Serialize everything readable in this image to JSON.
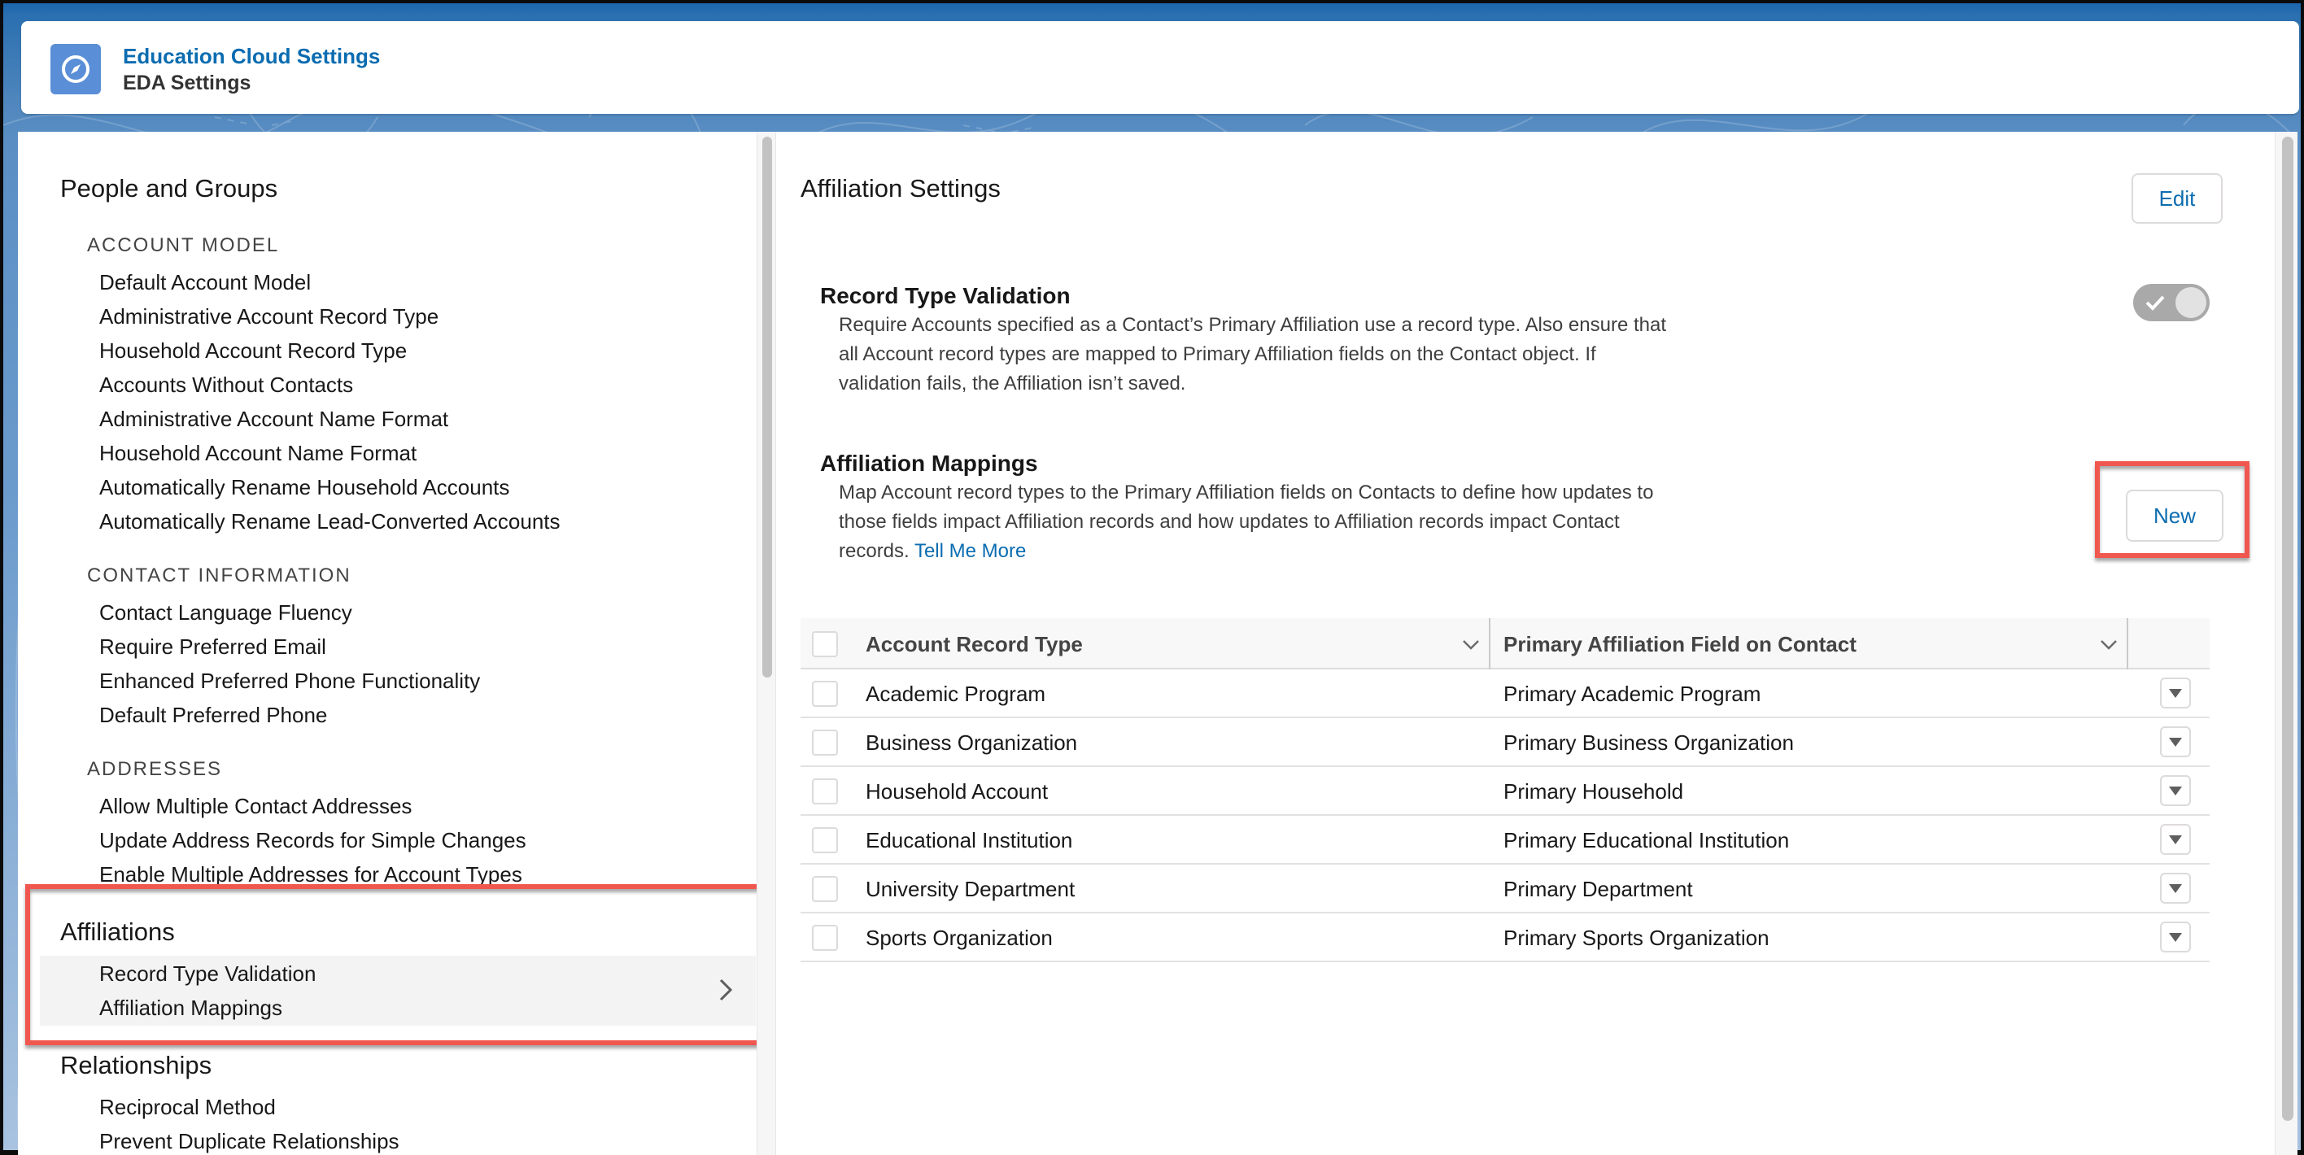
{
  "header": {
    "title": "Education Cloud Settings",
    "subtitle": "EDA Settings",
    "icon": "compass-icon",
    "title_color": "#0b6cb0",
    "icon_bg": "#5a8ed6"
  },
  "sidebar": {
    "groups": [
      {
        "title": "People and Groups",
        "sections": [
          {
            "label": "ACCOUNT MODEL",
            "items": [
              "Default Account Model",
              "Administrative Account Record Type",
              "Household Account Record Type",
              "Accounts Without Contacts",
              "Administrative Account Name Format",
              "Household Account Name Format",
              "Automatically Rename Household Accounts",
              "Automatically Rename Lead-Converted Accounts"
            ]
          },
          {
            "label": "CONTACT INFORMATION",
            "items": [
              "Contact Language Fluency",
              "Require Preferred Email",
              "Enhanced Preferred Phone Functionality",
              "Default Preferred Phone"
            ]
          },
          {
            "label": "ADDRESSES",
            "items": [
              "Allow Multiple Contact Addresses",
              "Update Address Records for Simple Changes",
              "Enable Multiple Addresses for Account Types"
            ]
          }
        ]
      },
      {
        "title": "Affiliations",
        "active": true,
        "items": [
          "Record Type Validation",
          "Affiliation Mappings"
        ]
      },
      {
        "title": "Relationships",
        "items": [
          "Reciprocal Method",
          "Prevent Duplicate Relationships"
        ]
      }
    ]
  },
  "main": {
    "heading": "Affiliation Settings",
    "edit_label": "Edit",
    "record_type_validation": {
      "title": "Record Type Validation",
      "description_lines": [
        "Require Accounts specified as a Contact’s Primary Affiliation use a record type. Also ensure that",
        "all Account record types are mapped to Primary Affiliation fields on the Contact object. If",
        "validation fails, the Affiliation isn’t saved."
      ],
      "toggle_checked": true,
      "toggle_disabled": true
    },
    "affiliation_mappings": {
      "title": "Affiliation Mappings",
      "description_lines": [
        "Map Account record types to the Primary Affiliation fields on Contacts to define how updates to",
        "those fields impact Affiliation records and how updates to Affiliation records impact Contact",
        "records. "
      ],
      "link_text": "Tell Me More",
      "new_label": "New"
    },
    "table": {
      "columns": [
        "Account Record Type",
        "Primary Affiliation Field on Contact"
      ],
      "rows": [
        [
          "Academic Program",
          "Primary Academic Program"
        ],
        [
          "Business Organization",
          "Primary Business Organization"
        ],
        [
          "Household Account",
          "Primary Household"
        ],
        [
          "Educational Institution",
          "Primary Educational Institution"
        ],
        [
          "University Department",
          "Primary Department"
        ],
        [
          "Sports Organization",
          "Primary Sports Organization"
        ]
      ]
    }
  },
  "annotations": {
    "highlight_color": "#f0574f",
    "highlighted": [
      "sidebar-group-affiliations",
      "new-mapping-button"
    ]
  }
}
